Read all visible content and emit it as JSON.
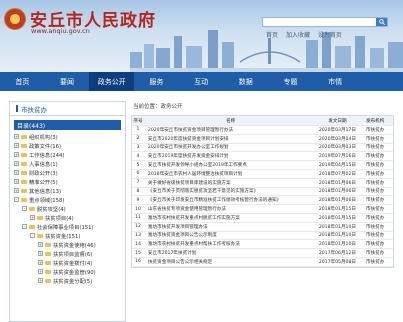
{
  "header": {
    "title": "安丘市人民政府",
    "url": "www.anqiu.gov.cn",
    "search_placeholder": "",
    "links": [
      "首页",
      "加入收藏",
      "设为首页"
    ]
  },
  "nav": [
    "首页",
    "要闻",
    "政务公开",
    "服务",
    "互动",
    "数据",
    "专题",
    "市情"
  ],
  "nav_active": 2,
  "sidebar": {
    "title": "市扶贫办",
    "total": "目录(443)",
    "items": [
      "组织机构(3)",
      "政策文件(16)",
      "工作信息(244)",
      "人事信息(1)",
      "财政公开(3)",
      "精准公开(5)",
      "其他信息(13)",
      "重点领域(158)",
      "脱贫攻坚(4)",
      "扶贫项目(4)",
      "社会保障事业项目(151)",
      "扶贫资金(151)",
      "扶贫资金使用(46)",
      "扶贫项目监督(6)",
      "扶贫资金拨付(4)",
      "扶贫资金监管(90)",
      "扶贫资金分配(5)"
    ]
  },
  "main": {
    "breadcrumb": "当前位置：政务公开",
    "columns": [
      "序号",
      "名称",
      "发文日期",
      "发布机构"
    ],
    "rows": [
      [
        "1",
        "2020年安丘市扶贫资金项目管理暂行办法",
        "2020年03月17日",
        "市扶贫办"
      ],
      [
        "2",
        "安丘市2020年度扶贫资金项目计划安排",
        "2020年03月04日",
        "市扶贫办"
      ],
      [
        "3",
        "2020年安丘市扶贫开发办公室工作规划",
        "2020年03月03日",
        "市扶贫办"
      ],
      [
        "4",
        "安丘市2019年度扶贫开发资金安排计划",
        "2019年07月16日",
        "市扶贫办"
      ],
      [
        "5",
        "安丘市扶贫开发领导小组办公室2019年工作要点",
        "2019年04月15日",
        "市扶贫办"
      ],
      [
        "6",
        "2018年安丘市农村人居环境整治扶贫项目计划",
        "2018年07月02日",
        "市扶贫办"
      ],
      [
        "7",
        "关于做好省级扶贫项目库建设的实施方案",
        "2018年01月06日",
        "市扶贫办"
      ],
      [
        "8",
        "《安丘市关于贯彻落实脱贫攻坚若干意见的实施方案》",
        "2018年01月06日",
        "市扶贫办"
      ],
      [
        "9",
        "《安丘市关于印发安丘市精准扶贫工作绩效考核暂行办法的通知》",
        "2018年01月06日",
        "市扶贫办"
      ],
      [
        "10",
        "山东省扶贫专项资金使用管理暂行办法",
        "2018年01月15日",
        "市扶贫办"
      ],
      [
        "11",
        "潍坊市农村扶贫开发重点村脱贫工作实施方案",
        "2018年01月15日",
        "市扶贫办"
      ],
      [
        "12",
        "潍坊市扶贫开发项目管理办法",
        "2018年01月10日",
        "市扶贫办"
      ],
      [
        "13",
        "潍坊市扶贫资金项目公告公示制度",
        "2018年01月10日",
        "市扶贫办"
      ],
      [
        "14",
        "潍坊市农村扶贫开发重点村帮扶工作考核办法",
        "2018年01月10日",
        "市扶贫办"
      ],
      [
        "15",
        "安丘市2017年扶贫计划",
        "2017年06月12日",
        "市扶贫办"
      ],
      [
        "16",
        "扶贫资金项目公告公示相关规定",
        "2017年05月08日",
        "市扶贫办"
      ]
    ]
  }
}
